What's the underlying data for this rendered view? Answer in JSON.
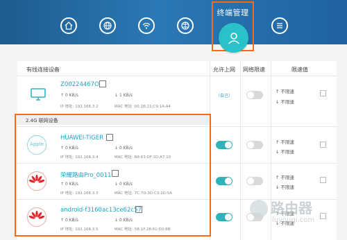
{
  "colors": {
    "header": "#2a78b5",
    "accent": "#29c2c8",
    "highlight": "#ff6a13",
    "link": "#1fa3c7",
    "huawei": "#e0262e"
  },
  "header": {
    "active_tab": "终端管理",
    "tabs": [
      "home-icon",
      "globe-icon",
      "wifi-icon",
      "globe-grid-icon",
      "user-icon",
      "menu-icon"
    ]
  },
  "table": {
    "headers": {
      "devices": "有线连接设备",
      "allow": "允许上网",
      "limit": "网络限速",
      "value": "限速值"
    },
    "wired_group": "有线连接设备",
    "wireless_group": "2.4G 联网设备"
  },
  "devices": [
    {
      "name": "Z00224467O",
      "up": "0 KB/s",
      "down": "1 KB/s",
      "ip": "IP 地址: 192.168.3.2",
      "mac": "MAC 地址: 00:1B:21:C9:1A:A4",
      "allow": "（自己）",
      "limit_up": "不限速",
      "limit_down": "不限速",
      "icon": "monitor-icon",
      "allow_on": null,
      "limit_on": false
    },
    {
      "name": "HUAWEI-TIGER",
      "up": "0 KB/s",
      "down": "0 KB/s",
      "ip": "IP 地址: 192.168.3.4",
      "mac": "MAC 地址: B8:63:DF:1D:A7:10",
      "logo": "Apple",
      "limit_up": "不限速",
      "limit_down": "不限速",
      "icon": "apple-logo",
      "allow_on": true,
      "limit_on": false
    },
    {
      "name": "荣耀路由Pro_0011",
      "up": "0 KB/s",
      "down": "0 KB/s",
      "ip": "IP 地址: 192.168.3.3",
      "mac": "MAC 地址: 7C:7D:3D:C3:2D:5A",
      "limit_up": "不限速",
      "limit_down": "不限速",
      "icon": "huawei-logo",
      "allow_on": true,
      "limit_on": false
    },
    {
      "name": "android-f3160ac13ce62c57",
      "up": "0 KB/s",
      "down": "0 KB/s",
      "ip": "IP 地址: 192.168.3.5",
      "mac": "MAC 地址: 5B:1F:28:61:D0:8B",
      "limit_up": "不限速",
      "limit_down": "不限速",
      "icon": "huawei-logo",
      "allow_on": true,
      "limit_on": false
    }
  ],
  "watermark": {
    "text": "路由器",
    "url": "luyouqi.com"
  }
}
